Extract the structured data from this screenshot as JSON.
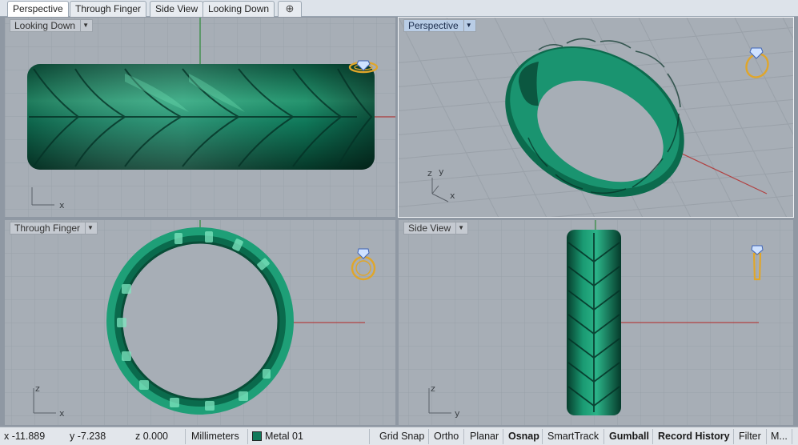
{
  "tabs": [
    {
      "label": "Perspective",
      "active": true
    },
    {
      "label": "Through Finger",
      "active": false
    },
    {
      "label": "Side View",
      "active": false
    },
    {
      "label": "Looking Down",
      "active": false
    }
  ],
  "add_tab_symbol": "⊕",
  "viewports": {
    "top_left": {
      "label": "Looking Down",
      "axes": {
        "horizontal": "x",
        "vertical": ""
      }
    },
    "top_right": {
      "label": "Perspective",
      "axes": {
        "z": "z",
        "y": "y",
        "x": "x"
      }
    },
    "bottom_left": {
      "label": "Through Finger",
      "axes": {
        "horizontal": "x",
        "vertical": "z"
      }
    },
    "bottom_right": {
      "label": "Side View",
      "axes": {
        "horizontal": "y",
        "vertical": "z"
      }
    }
  },
  "colors": {
    "ring_green": "#117a5b",
    "viewport_bg": "#a7aeb6",
    "grid_line": "#9aa1a9",
    "axis_red": "#b14242",
    "axis_green": "#2f8a3a",
    "active_label_bg": "#b9cde6",
    "ring_widget_gold": "#e0a62a"
  },
  "icons": {
    "dropdown": "chevron-down-icon",
    "ring_view_widget": "ring-view-icon",
    "add_tab": "plus-icon"
  },
  "status": {
    "x": "x -11.889",
    "y": "y -7.238",
    "z": "z 0.000",
    "units": "Millimeters",
    "layer": "Metal 01",
    "toggles": [
      {
        "label": "Grid Snap",
        "on": false
      },
      {
        "label": "Ortho",
        "on": false
      },
      {
        "label": "Planar",
        "on": false
      },
      {
        "label": "Osnap",
        "on": true
      },
      {
        "label": "SmartTrack",
        "on": false
      },
      {
        "label": "Gumball",
        "on": true
      },
      {
        "label": "Record History",
        "on": true
      },
      {
        "label": "Filter",
        "on": false
      },
      {
        "label": "M...",
        "on": false
      }
    ]
  }
}
